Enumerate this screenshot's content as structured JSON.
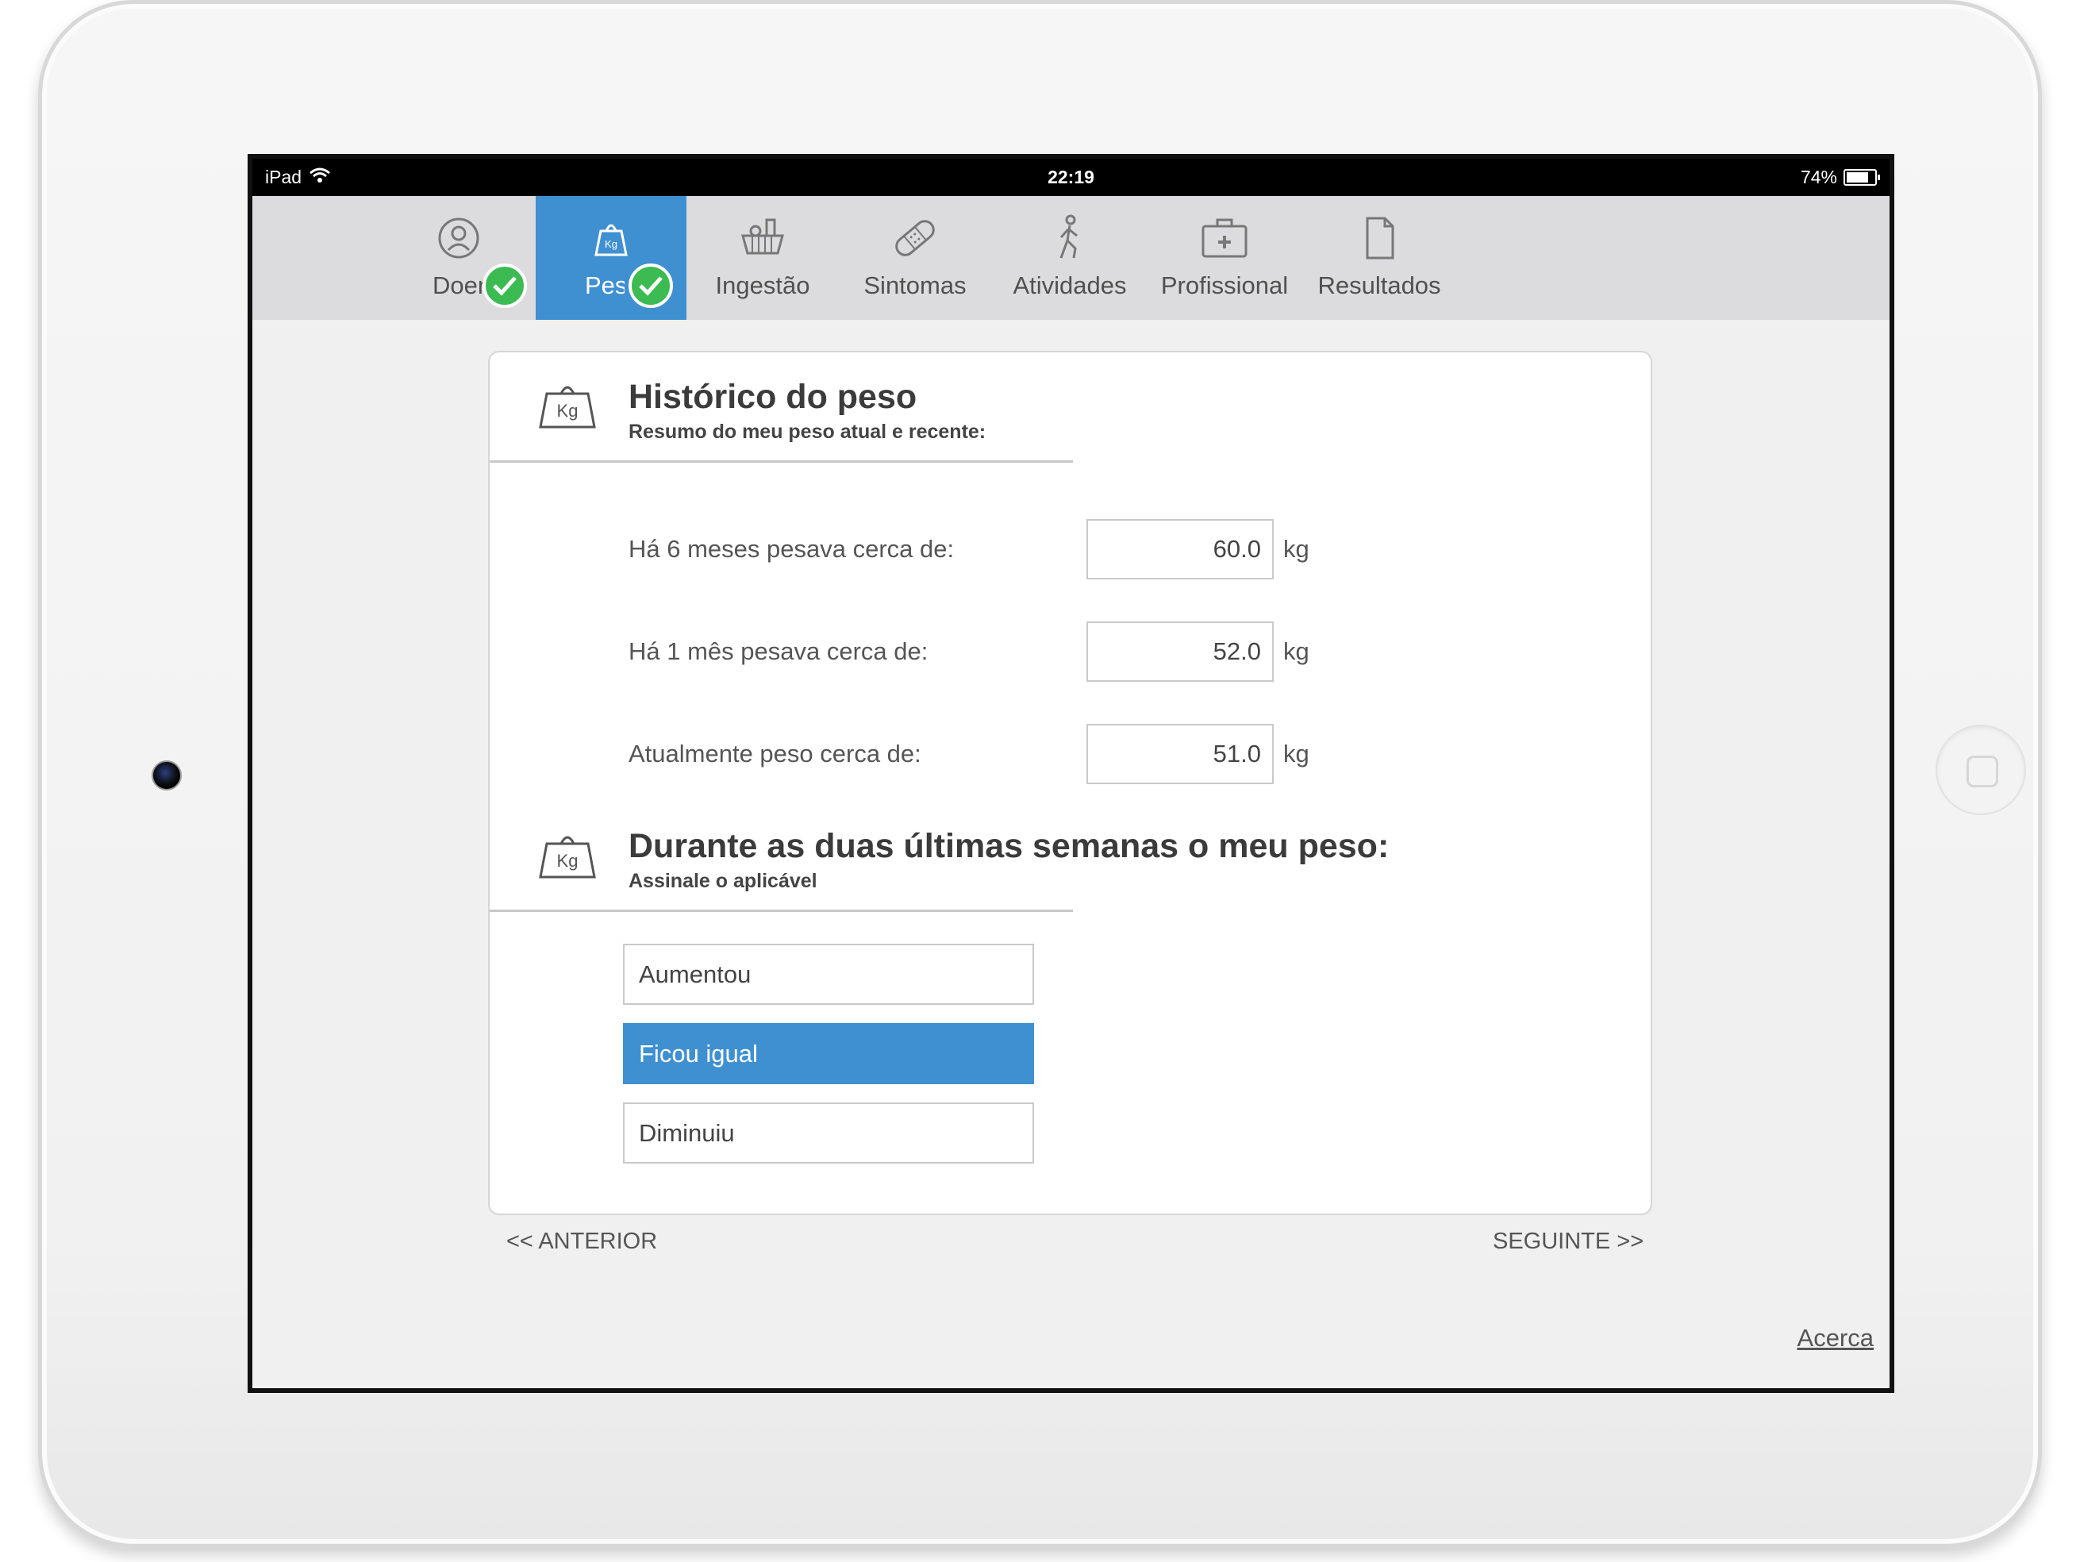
{
  "status_bar": {
    "device": "iPad",
    "time": "22:19",
    "battery": "74%",
    "icons": [
      "wifi-icon",
      "battery-icon"
    ]
  },
  "tabs": [
    {
      "label": "Doen",
      "icon": "person-icon",
      "completed": true,
      "active": false
    },
    {
      "label": "Peso",
      "icon": "weight-kg-icon",
      "completed": true,
      "active": true
    },
    {
      "label": "Ingestão",
      "icon": "food-basket-icon",
      "completed": false,
      "active": false
    },
    {
      "label": "Sintomas",
      "icon": "bandage-icon",
      "completed": false,
      "active": false
    },
    {
      "label": "Atividades",
      "icon": "walking-person-icon",
      "completed": false,
      "active": false
    },
    {
      "label": "Profissional",
      "icon": "medical-kit-icon",
      "completed": false,
      "active": false
    },
    {
      "label": "Resultados",
      "icon": "document-icon",
      "completed": false,
      "active": false
    }
  ],
  "history": {
    "title": "Histórico do peso",
    "subtitle": "Resumo do meu peso atual e recente:",
    "icon_label": "Kg",
    "rows": [
      {
        "label": "Há 6 meses pesava cerca de:",
        "value": "60.0",
        "unit": "kg"
      },
      {
        "label": "Há 1 mês pesava cerca de:",
        "value": "52.0",
        "unit": "kg"
      },
      {
        "label": "Atualmente peso cerca de:",
        "value": "51.0",
        "unit": "kg"
      }
    ]
  },
  "trend": {
    "title": "Durante as duas últimas semanas o meu peso:",
    "subtitle": "Assinale o aplicável",
    "icon_label": "Kg",
    "options": [
      {
        "label": "Aumentou",
        "selected": false
      },
      {
        "label": "Ficou igual",
        "selected": true
      },
      {
        "label": "Diminuiu",
        "selected": false
      }
    ]
  },
  "navigation": {
    "previous": "<< ANTERIOR",
    "next": "SEGUINTE >>",
    "about": "Acerca"
  },
  "colors": {
    "accent": "#3f90d1",
    "check": "#3dbb53",
    "tabbar": "#dcdcde",
    "background": "#f0f0f0"
  }
}
